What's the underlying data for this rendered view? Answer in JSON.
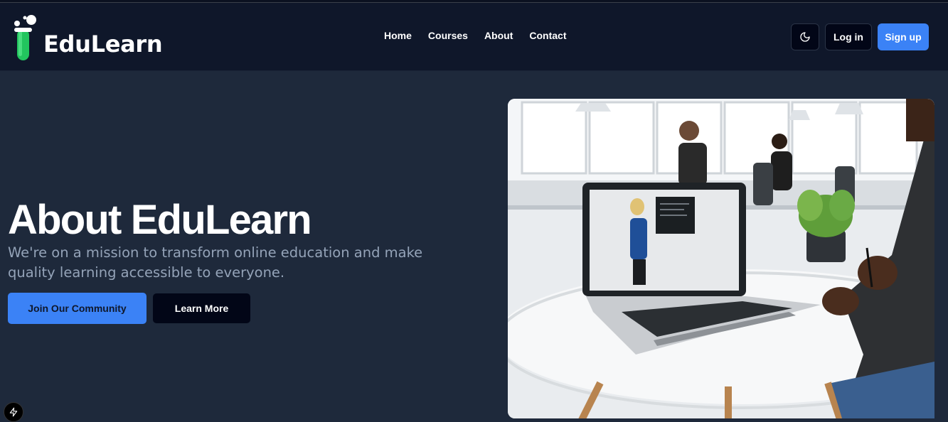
{
  "brand": {
    "name": "EduLearn",
    "logo_icon": "test-tube-logo-icon",
    "accent_color": "#22c55e"
  },
  "nav": {
    "links": [
      "Home",
      "Courses",
      "About",
      "Contact"
    ]
  },
  "header": {
    "theme_icon": "moon-icon",
    "login_label": "Log in",
    "signup_label": "Sign up",
    "signup_color": "#3b82f6"
  },
  "hero": {
    "title": "About EduLearn",
    "subtitle": "We're on a mission to transform online education and make quality learning accessible to everyone.",
    "primary_cta": "Join Our Community",
    "secondary_cta": "Learn More",
    "image_subject": "hero-photo"
  },
  "dev_tools": {
    "icon": "lightning-icon"
  },
  "colors": {
    "page_bg": "#1e293b",
    "nav_bg": "#0f172a",
    "muted_text": "#94a3b8",
    "primary": "#3b82f6"
  }
}
